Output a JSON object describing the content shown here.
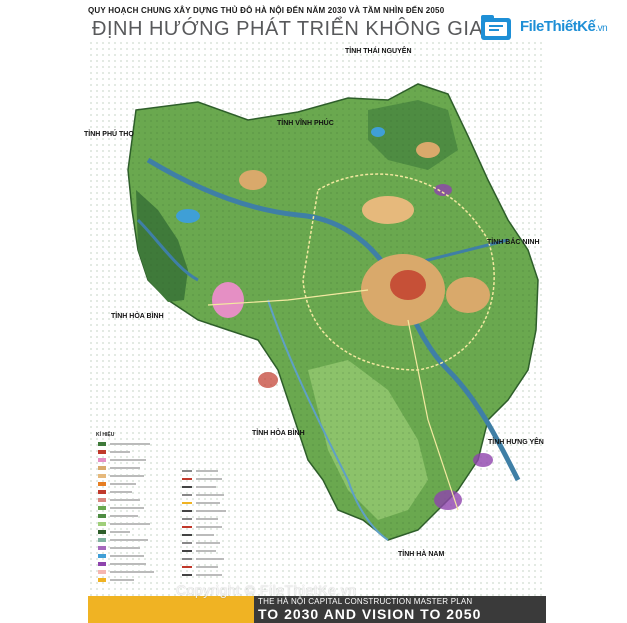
{
  "header": {
    "top_title": "QUY HOẠCH CHUNG XÂY DỰNG THỦ ĐÔ HÀ NỘI ĐẾN NĂM 2030 VÀ TẦM NHÌN ĐẾN 2050",
    "main_title": "ĐỊNH HƯỚNG PHÁT TRIỂN KHÔNG GIAN"
  },
  "logo": {
    "brand": "FileThiếtKế",
    "tld": ".vn",
    "icon": "file-folder-icon"
  },
  "map": {
    "province_labels": {
      "thai_nguyen": "TỈNH THÁI NGUYÊN",
      "vinh_phuc": "TỈNH VĨNH PHÚC",
      "phu_tho": "TỈNH PHÚ THỌ",
      "bac_ninh": "TỈNH BẮC NINH",
      "hoa_binh_west": "TỈNH HÒA BÌNH",
      "hoa_binh_south": "TỈNH HÒA BÌNH",
      "hung_yen": "TỈNH HƯNG YÊN",
      "ha_nam": "TỈNH HÀ NAM"
    },
    "colors": {
      "green_dark": "#3f7a3a",
      "green_mid": "#6aa84f",
      "green_light": "#9fcf7a",
      "river": "#3f7fa6",
      "urban": "#d9a96b",
      "urban_red": "#c0392b",
      "purple": "#8e44ad",
      "pink": "#e58fc4"
    }
  },
  "legend": {
    "title": "KÍ HIỆU"
  },
  "footer": {
    "subtitle": "THE HÀ NỘI CAPITAL CONSTRUCTION MASTER PLAN",
    "main": "TO 2030 AND VISION TO 2050",
    "watermark": "Copyright © FileThietKe.vn"
  }
}
